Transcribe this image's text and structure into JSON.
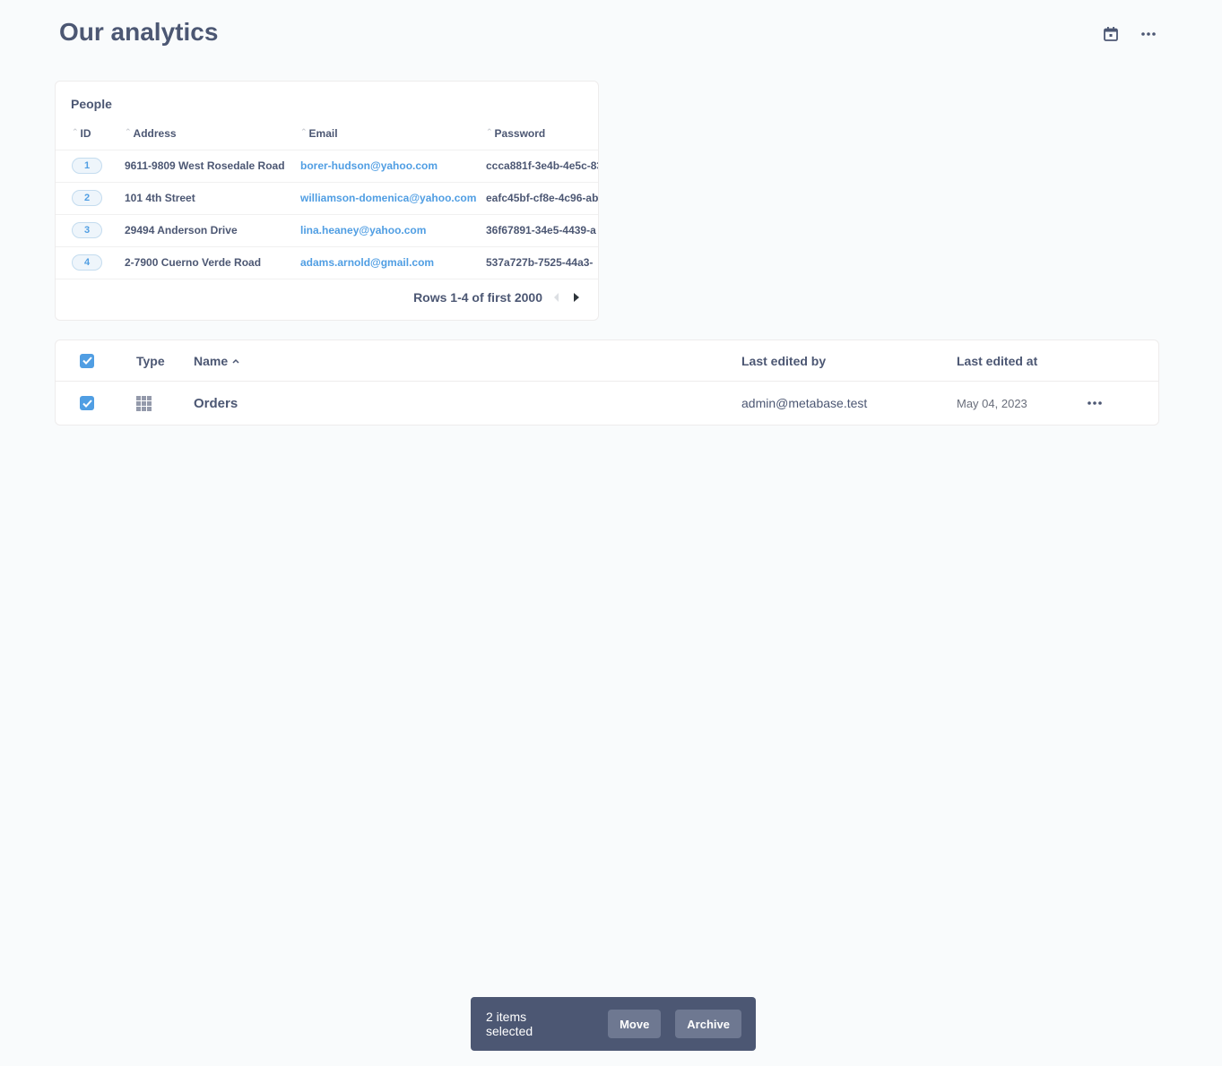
{
  "page": {
    "title": "Our analytics"
  },
  "pinned": {
    "title": "People",
    "columns": [
      "ID",
      "Address",
      "Email",
      "Password"
    ],
    "rows": [
      {
        "id": "1",
        "address": "9611-9809 West Rosedale Road",
        "email": "borer-hudson@yahoo.com",
        "password": "ccca881f-3e4b-4e5c-83"
      },
      {
        "id": "2",
        "address": "101 4th Street",
        "email": "williamson-domenica@yahoo.com",
        "password": "eafc45bf-cf8e-4c96-ab"
      },
      {
        "id": "3",
        "address": "29494 Anderson Drive",
        "email": "lina.heaney@yahoo.com",
        "password": "36f67891-34e5-4439-a"
      },
      {
        "id": "4",
        "address": "2-7900 Cuerno Verde Road",
        "email": "adams.arnold@gmail.com",
        "password": "537a727b-7525-44a3-"
      }
    ],
    "pagination": "Rows 1-4 of first 2000"
  },
  "items": {
    "headers": {
      "type": "Type",
      "name": "Name",
      "editor": "Last edited by",
      "date": "Last edited at"
    },
    "rows": [
      {
        "name": "Orders",
        "editor": "admin@metabase.test",
        "date": "May 04, 2023"
      }
    ]
  },
  "bulk": {
    "count": "2 items selected",
    "move": "Move",
    "archive": "Archive"
  },
  "colors": {
    "brand": "#509ee3",
    "text": "#4c5773",
    "bar": "#4c5773"
  }
}
